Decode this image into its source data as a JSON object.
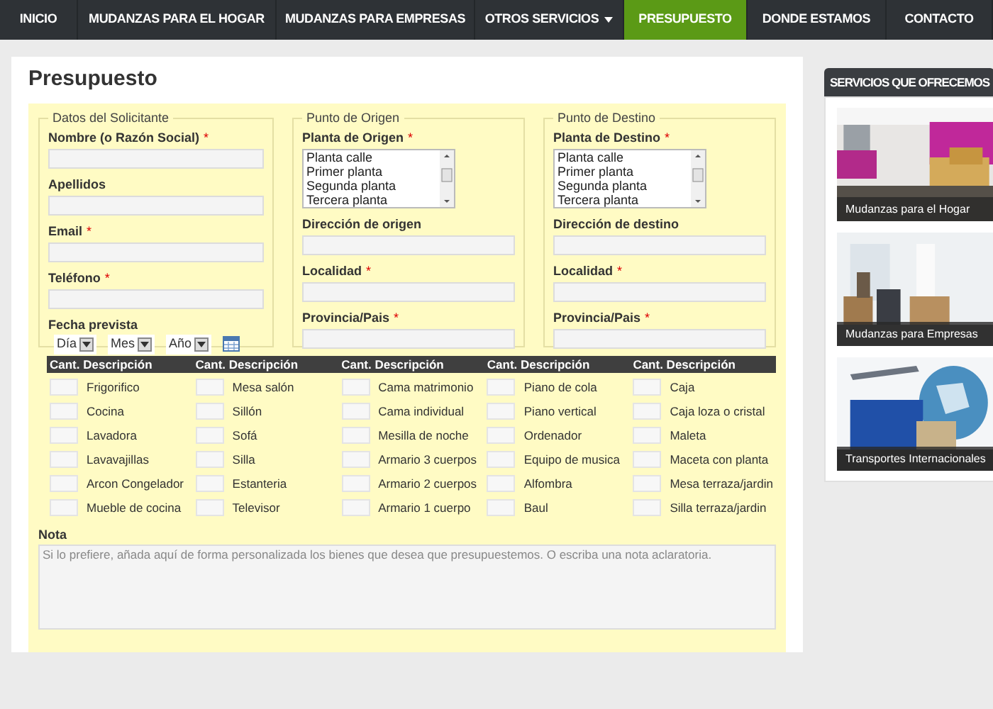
{
  "nav": [
    {
      "label": "INICIO",
      "selected": false
    },
    {
      "label": "MUDANZAS PARA EL HOGAR",
      "selected": false
    },
    {
      "label": "MUDANZAS PARA EMPRESAS",
      "selected": false
    },
    {
      "label": "OTROS SERVICIOS",
      "selected": false,
      "dropdown": true
    },
    {
      "label": "PRESUPUESTO",
      "selected": true
    },
    {
      "label": "DONDE ESTAMOS",
      "selected": false
    },
    {
      "label": "CONTACTO",
      "selected": false
    }
  ],
  "title": "Presupuesto",
  "fieldsets": [
    {
      "legend": "Datos del Solicitante",
      "fields": [
        {
          "kind": "text",
          "label": "Nombre (o Razón Social)",
          "required_mark": "*"
        },
        {
          "kind": "text",
          "label": "Apellidos"
        },
        {
          "kind": "text",
          "label": "Email",
          "required_mark": "*"
        },
        {
          "kind": "text",
          "label": "Teléfono",
          "required_mark": "*"
        },
        {
          "kind": "date",
          "label": "Fecha prevista",
          "selects": [
            "Día",
            "Mes",
            "Año"
          ]
        }
      ]
    },
    {
      "legend": "Punto de Origen",
      "fields": [
        {
          "kind": "list",
          "label": "Planta de Origen",
          "required_mark": "*",
          "options": [
            "Planta calle",
            "Primer planta",
            "Segunda planta",
            "Tercera planta"
          ]
        },
        {
          "kind": "text",
          "label": "Dirección de origen"
        },
        {
          "kind": "text",
          "label": "Localidad",
          "required_mark": "*"
        },
        {
          "kind": "text",
          "label": "Provincia/Pais",
          "required_mark": "*"
        }
      ]
    },
    {
      "legend": "Punto de Destino",
      "fields": [
        {
          "kind": "list",
          "label": "Planta de Destino",
          "required_mark": "*",
          "options": [
            "Planta calle",
            "Primer planta",
            "Segunda planta",
            "Tercera planta"
          ]
        },
        {
          "kind": "text",
          "label": "Dirección de destino"
        },
        {
          "kind": "text",
          "label": "Localidad",
          "required_mark": "*"
        },
        {
          "kind": "text",
          "label": "Provincia/Pais",
          "required_mark": "*"
        }
      ]
    }
  ],
  "items": {
    "columns": [
      {
        "header": "Cant. Descripción",
        "items": [
          "Frigorifico",
          "Cocina",
          "Lavadora",
          "Lavavajillas",
          "Arcon Congelador",
          "Mueble de cocina"
        ]
      },
      {
        "header": "Cant. Descripción",
        "items": [
          "Mesa salón",
          "Sillón",
          "Sofá",
          "Silla",
          "Estanteria",
          "Televisor"
        ]
      },
      {
        "header": "Cant. Descripción",
        "items": [
          "Cama matrimonio",
          "Cama individual",
          "Mesilla de noche",
          "Armario 3 cuerpos",
          "Armario 2 cuerpos",
          "Armario 1 cuerpo"
        ]
      },
      {
        "header": "Cant. Descripción",
        "items": [
          "Piano de cola",
          "Piano vertical",
          "Ordenador",
          "Equipo de musica",
          "Alfombra",
          "Baul"
        ]
      },
      {
        "header": "Cant. Descripción",
        "items": [
          "Caja",
          "Caja loza o cristal",
          "Maleta",
          "Maceta con planta",
          "Mesa terraza/jardin",
          "Silla terraza/jardin"
        ]
      }
    ]
  },
  "note": {
    "label": "Nota",
    "placeholder": "Si lo prefiere, añada aquí de forma personalizada los bienes que desea que presupuestemos. O escriba una nota aclaratoria."
  },
  "sidebar": {
    "title": "SERVICIOS QUE OFRECEMOS",
    "cards": [
      {
        "kind": "home",
        "caption": "Mudanzas para el Hogar"
      },
      {
        "kind": "office",
        "caption": "Mudanzas para Empresas"
      },
      {
        "kind": "transport",
        "caption": "Transportes Internacionales"
      }
    ]
  }
}
